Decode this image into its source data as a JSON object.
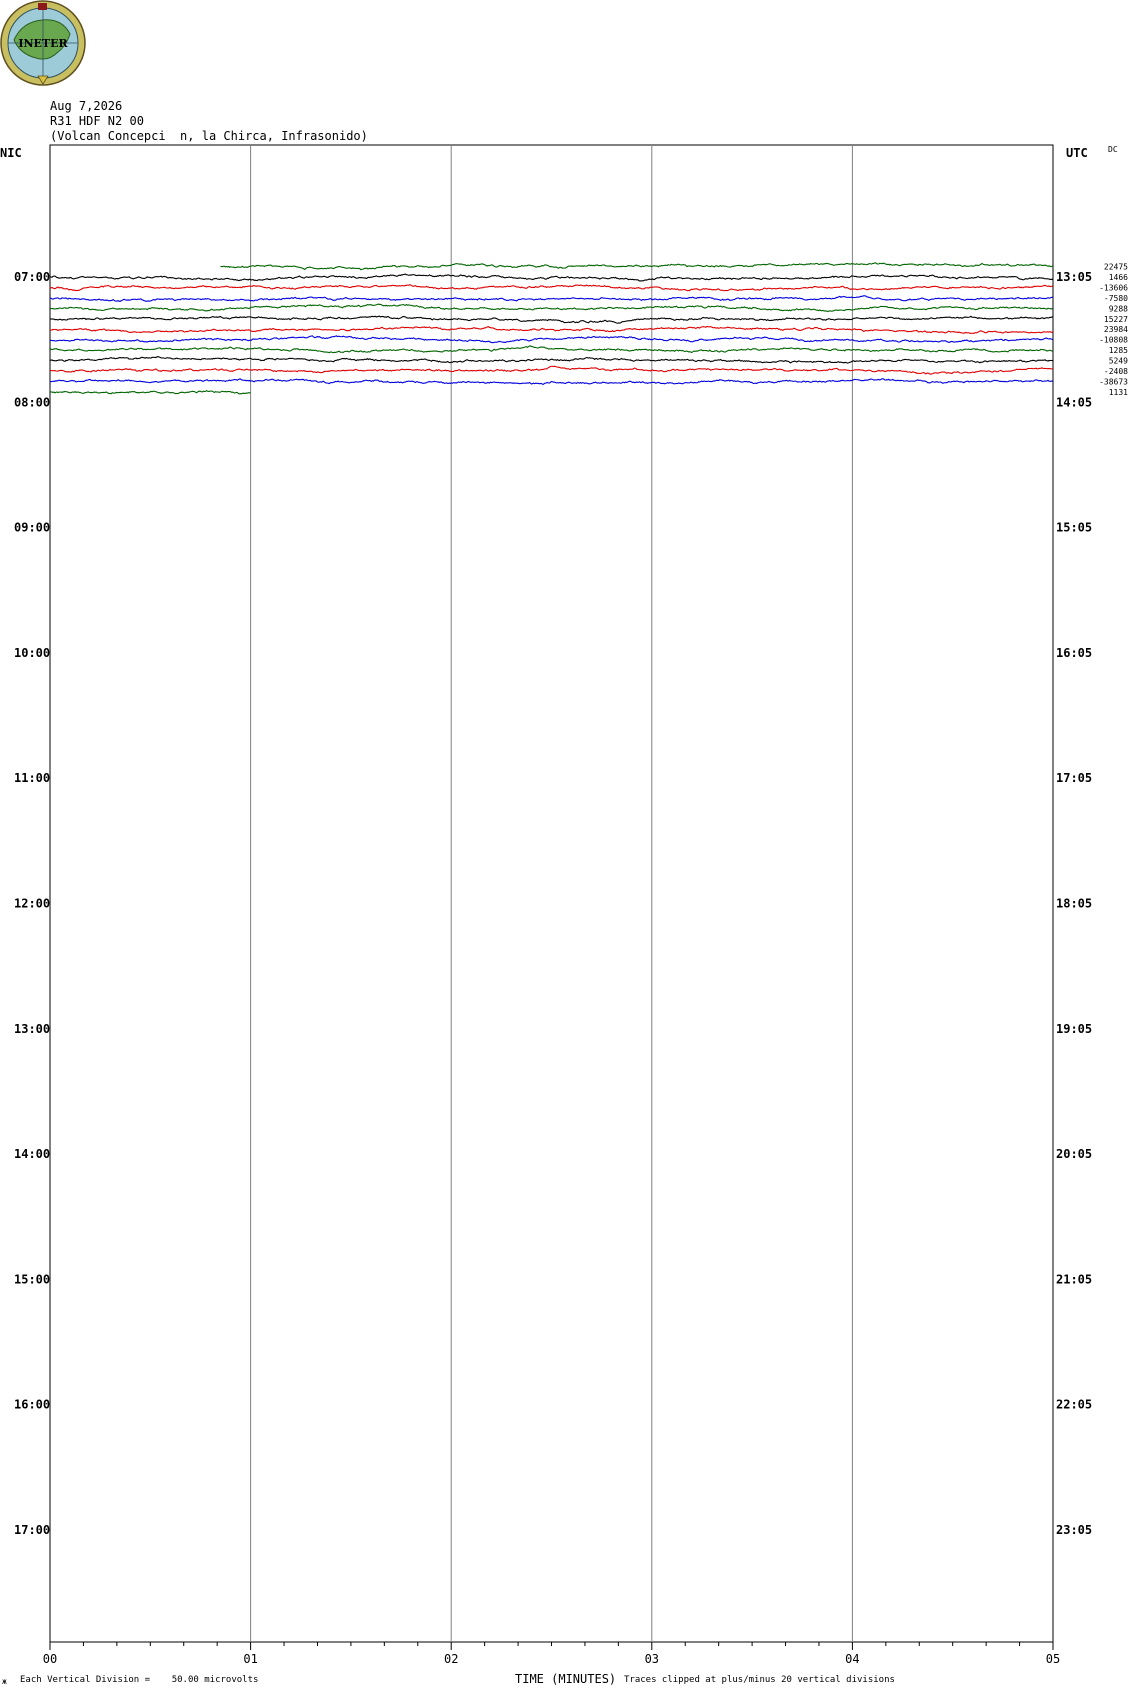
{
  "logo": {
    "text": "INETER"
  },
  "header": {
    "date": "Aug 7,2026",
    "station": "R31 HDF N2 00",
    "location": "(Volcan Concepci  n, la Chirca, Infrasonido)"
  },
  "corner": {
    "left": "NIC",
    "right": "UTC",
    "dc_label": "DC"
  },
  "footer": {
    "scale": "Each Vertical Division =    50.00 microvolts",
    "xlabel": "TIME (MINUTES)",
    "clip_note": "Traces clipped at plus/minus 20 vertical divisions",
    "corner_mark": "ж"
  },
  "colors": {
    "black": "#000000",
    "red": "#e00000",
    "blue": "#0000e0",
    "green": "#006400",
    "grid": "#808080"
  },
  "chart_data": {
    "type": "line",
    "title": "R31 HDF N2 00",
    "xlabel": "TIME (MINUTES)",
    "ylabel": "",
    "xlim": [
      0,
      5
    ],
    "x_ticks": [
      "00",
      "01",
      "02",
      "03",
      "04",
      "05"
    ],
    "grid": true,
    "left_hour_labels": [
      "07:00",
      "08:00",
      "09:00",
      "10:00",
      "11:00",
      "12:00",
      "13:00",
      "14:00",
      "15:00",
      "16:00",
      "17:00"
    ],
    "right_hour_labels": [
      "13:05",
      "14:05",
      "15:05",
      "16:05",
      "17:05",
      "18:05",
      "19:05",
      "20:05",
      "21:05",
      "22:05",
      "23:05"
    ],
    "lines_per_hour": 12,
    "traces": [
      {
        "row": -1,
        "color": "green",
        "start": 0.85,
        "end": 5.0,
        "dc": "22475"
      },
      {
        "row": 0,
        "color": "black",
        "start": 0.0,
        "end": 5.0,
        "dc": "1466"
      },
      {
        "row": 1,
        "color": "red",
        "start": 0.0,
        "end": 5.0,
        "dc": "-13606"
      },
      {
        "row": 2,
        "color": "blue",
        "start": 0.0,
        "end": 5.0,
        "dc": "-7580"
      },
      {
        "row": 3,
        "color": "green",
        "start": 0.0,
        "end": 5.0,
        "dc": "9288"
      },
      {
        "row": 4,
        "color": "black",
        "start": 0.0,
        "end": 5.0,
        "dc": "15227"
      },
      {
        "row": 5,
        "color": "red",
        "start": 0.0,
        "end": 5.0,
        "dc": "23984"
      },
      {
        "row": 6,
        "color": "blue",
        "start": 0.0,
        "end": 5.0,
        "dc": "-10808"
      },
      {
        "row": 7,
        "color": "green",
        "start": 0.0,
        "end": 5.0,
        "dc": "1285"
      },
      {
        "row": 8,
        "color": "black",
        "start": 0.0,
        "end": 5.0,
        "dc": "5249"
      },
      {
        "row": 9,
        "color": "red",
        "start": 0.0,
        "end": 5.0,
        "dc": "-2408"
      },
      {
        "row": 10,
        "color": "blue",
        "start": 0.0,
        "end": 5.0,
        "dc": "-38673"
      },
      {
        "row": 11,
        "color": "green",
        "start": 0.0,
        "end": 1.0,
        "dc": "1131"
      }
    ]
  }
}
